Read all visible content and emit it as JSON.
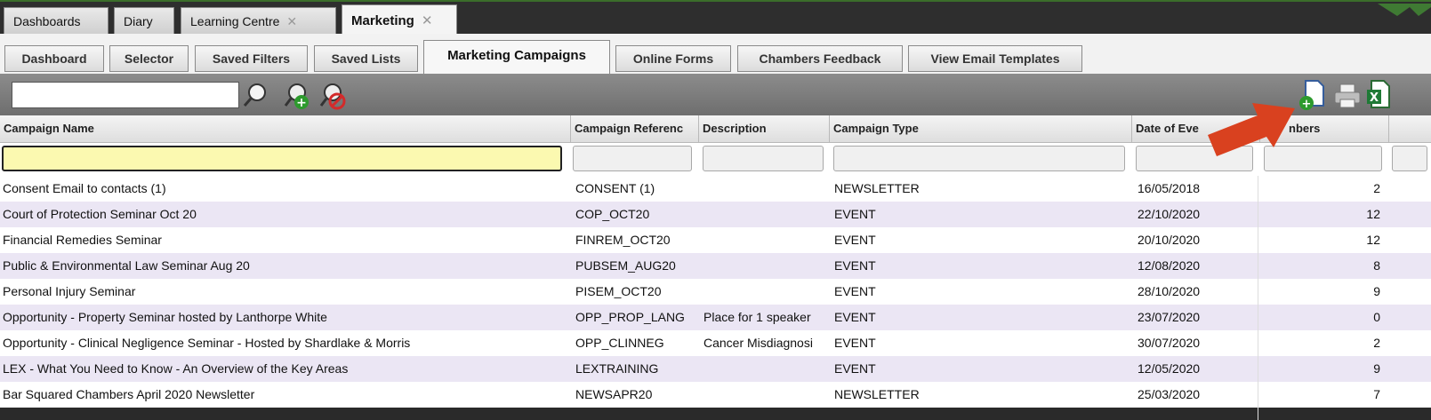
{
  "top_tabs": [
    {
      "label": "Dashboards",
      "closable": false
    },
    {
      "label": "Diary",
      "closable": false
    },
    {
      "label": "Learning Centre",
      "closable": true
    },
    {
      "label": "Marketing",
      "closable": true,
      "active": true
    }
  ],
  "sub_tabs": [
    {
      "label": "Dashboard"
    },
    {
      "label": "Selector"
    },
    {
      "label": "Saved Filters"
    },
    {
      "label": "Saved Lists"
    },
    {
      "label": "Marketing Campaigns",
      "active": true
    },
    {
      "label": "Online Forms"
    },
    {
      "label": "Chambers Feedback"
    },
    {
      "label": "View Email Templates"
    }
  ],
  "toolbar": {
    "search_value": "",
    "icons": [
      "search-icon",
      "add-filter-icon",
      "remove-filter-icon",
      "new-document-icon",
      "print-icon",
      "excel-export-icon"
    ]
  },
  "columns": [
    {
      "key": "name",
      "label": "Campaign Name"
    },
    {
      "key": "ref",
      "label": "Campaign Referenc"
    },
    {
      "key": "desc",
      "label": "Description"
    },
    {
      "key": "type",
      "label": "Campaign Type"
    },
    {
      "key": "date",
      "label": "Date of Eve"
    },
    {
      "key": "members",
      "label": "nbers"
    }
  ],
  "rows": [
    {
      "name": "Consent Email to contacts (1)",
      "ref": "CONSENT (1)",
      "desc": "",
      "type": "NEWSLETTER",
      "date": "16/05/2018",
      "members": "2"
    },
    {
      "name": "Court of Protection Seminar Oct 20",
      "ref": "COP_OCT20",
      "desc": "",
      "type": "EVENT",
      "date": "22/10/2020",
      "members": "12"
    },
    {
      "name": "Financial Remedies Seminar",
      "ref": "FINREM_OCT20",
      "desc": "",
      "type": "EVENT",
      "date": "20/10/2020",
      "members": "12"
    },
    {
      "name": "Public & Environmental Law Seminar Aug 20",
      "ref": "PUBSEM_AUG20",
      "desc": "",
      "type": "EVENT",
      "date": "12/08/2020",
      "members": "8"
    },
    {
      "name": "Personal Injury Seminar",
      "ref": "PISEM_OCT20",
      "desc": "",
      "type": "EVENT",
      "date": "28/10/2020",
      "members": "9"
    },
    {
      "name": "Opportunity - Property Seminar hosted by Lanthorpe White",
      "ref": "OPP_PROP_LANG",
      "desc": "Place for 1 speaker",
      "type": "EVENT",
      "date": "23/07/2020",
      "members": "0"
    },
    {
      "name": "Opportunity - Clinical Negligence Seminar - Hosted by Shardlake & Morris",
      "ref": "OPP_CLINNEG",
      "desc": "Cancer Misdiagnosi",
      "type": "EVENT",
      "date": "30/07/2020",
      "members": "2"
    },
    {
      "name": "LEX - What You Need to Know - An Overview of the Key Areas",
      "ref": "LEXTRAINING",
      "desc": "",
      "type": "EVENT",
      "date": "12/05/2020",
      "members": "9"
    },
    {
      "name": "Bar Squared Chambers April 2020 Newsletter",
      "ref": "NEWSAPR20",
      "desc": "",
      "type": "NEWSLETTER",
      "date": "25/03/2020",
      "members": "7"
    }
  ],
  "colors": {
    "accent_arrow": "#d9411f",
    "row_alt": "#ebe6f4",
    "filter_active": "#fbf9b0"
  }
}
